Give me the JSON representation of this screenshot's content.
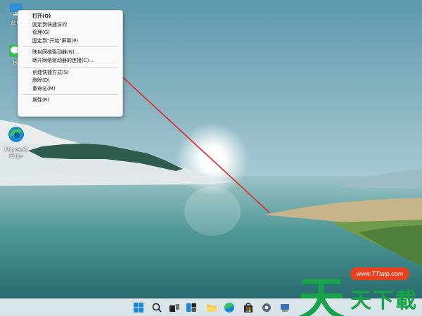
{
  "desktop": {
    "icons": [
      {
        "name": "this-pc",
        "label": "此电"
      },
      {
        "name": "wechat",
        "label": "微"
      },
      {
        "name": "microsoft-edge",
        "label": "Microsoft Edge"
      }
    ]
  },
  "context_menu": {
    "items": [
      {
        "label": "打开(O)",
        "bold": true
      },
      {
        "label": "固定到快速访问"
      },
      {
        "label": "管理(G)"
      },
      {
        "label": "固定到\"开始\"屏幕(P)"
      },
      {
        "label": "映射网络驱动器(N)..."
      },
      {
        "label": "断开网络驱动器的连接(C)..."
      },
      {
        "label": "创建快捷方式(S)"
      },
      {
        "label": "删除(D)"
      },
      {
        "label": "重命名(M)"
      },
      {
        "label": "属性(R)"
      }
    ]
  },
  "taskbar": {
    "icons": [
      "windows-start-icon",
      "search-icon",
      "task-view-icon",
      "widgets-icon",
      "file-explorer-icon",
      "edge-icon",
      "store-icon",
      "settings-icon",
      "network-drive-icon"
    ]
  },
  "watermark": {
    "url": "www.TTtalp.com",
    "chars": [
      "天",
      "天",
      "下",
      "載"
    ]
  },
  "colors": {
    "arrow": "#e0262b",
    "watermark_green": "#16a34a",
    "watermark_badge": "#e8401c"
  }
}
